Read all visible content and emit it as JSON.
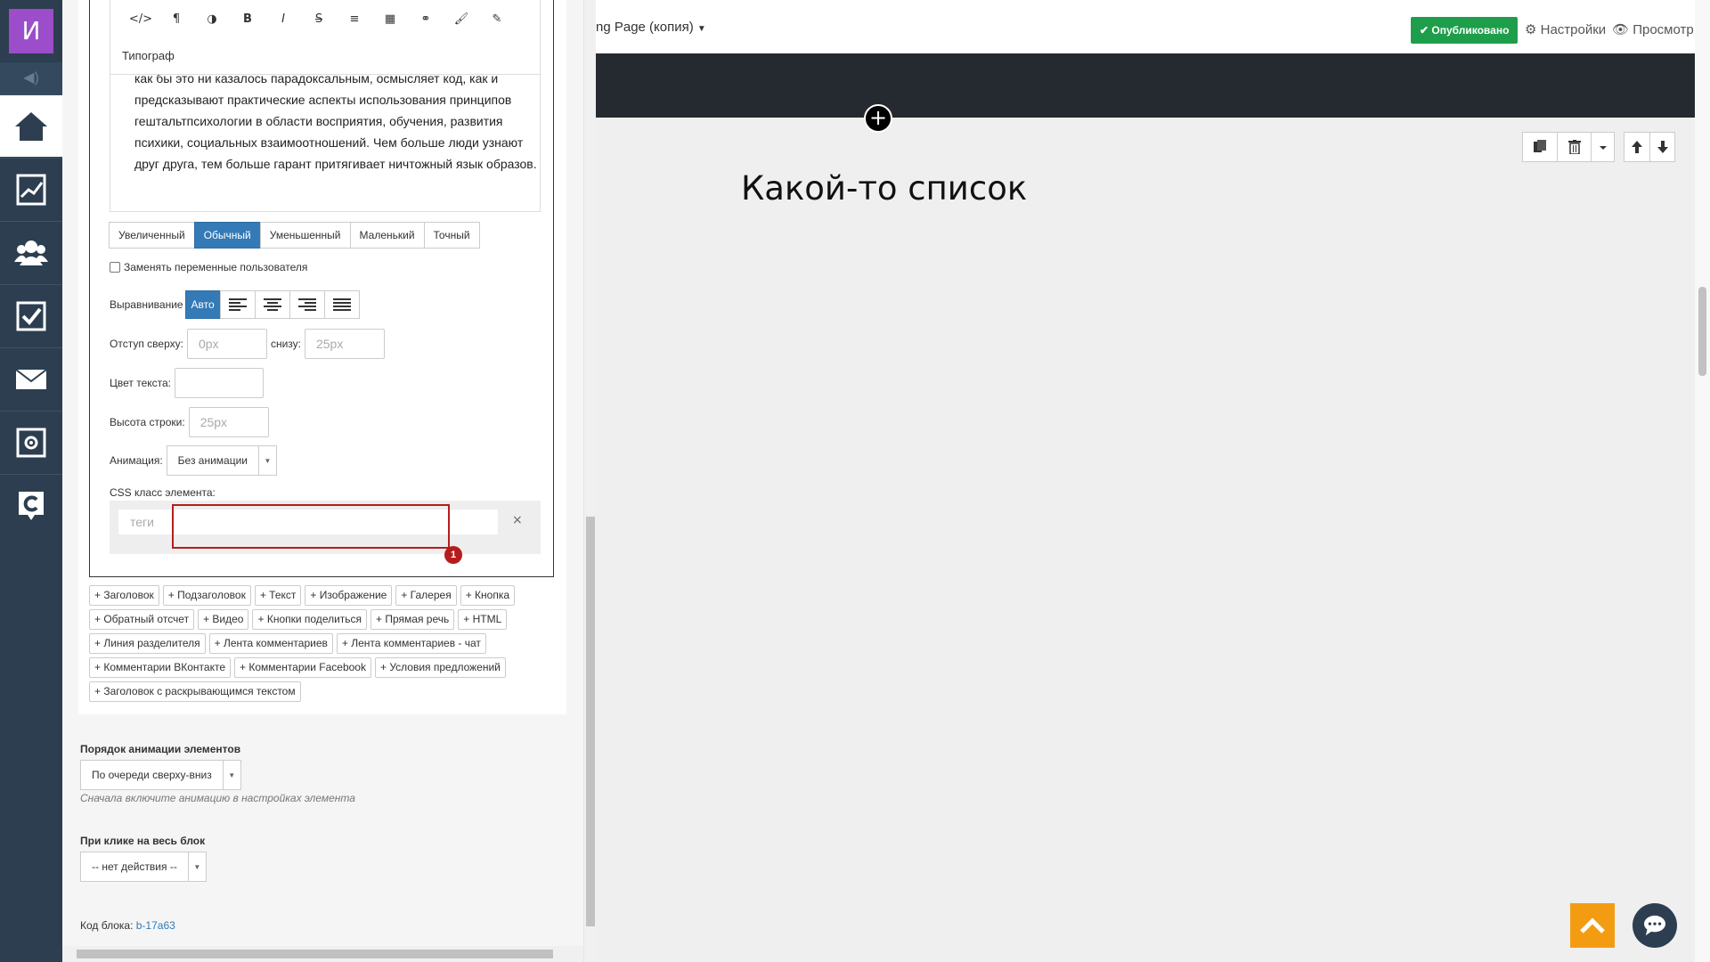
{
  "logo": "И",
  "nav": [
    "home",
    "stats",
    "users",
    "tasks",
    "mail",
    "settings",
    "crm"
  ],
  "editor": {
    "toolbar_icons": [
      "</>",
      "¶",
      "◑",
      "B",
      "I",
      "S",
      "≡",
      "▦",
      "⚭",
      "🖌",
      "✎"
    ],
    "tipograf": "Типограф",
    "text": "как бы это ни казалось парадоксальным, осмысляет код, как и предсказывают практические аспекты использования принципов гештальтпсихологии в области восприятия, обучения, развития психики, социальных взаимоотношений. Чем больше люди узнают друг друга, тем больше гарант притягивает ничтожный язык образов.",
    "sizes": [
      "Увеличенный",
      "Обычный",
      "Уменьшенный",
      "Маленький",
      "Точный"
    ],
    "active_size": "Обычный",
    "replace_vars_label": "Заменять переменные пользователя",
    "align_label": "Выравнивание",
    "align_auto": "Авто",
    "margin_top_label": "Отступ сверху:",
    "margin_top_placeholder": "0px",
    "margin_bottom_label": "снизу:",
    "margin_bottom_placeholder": "25px",
    "text_color_label": "Цвет текста:",
    "line_height_label": "Высота строки:",
    "line_height_placeholder": "25px",
    "animation_label": "Анимация:",
    "animation_value": "Без анимации",
    "css_class_label": "CSS класс элемента:",
    "tags_placeholder": "теги",
    "tags_clear": "×",
    "badge": "1"
  },
  "add_buttons": [
    "+ Заголовок",
    "+ Подзаголовок",
    "+ Текст",
    "+ Изображение",
    "+ Галерея",
    "+ Кнопка",
    "+ Обратный отсчет",
    "+ Видео",
    "+ Кнопки поделиться",
    "+ Прямая речь",
    "+ HTML",
    "+ Линия разделителя",
    "+ Лента комментариев",
    "+ Лента комментариев - чат",
    "+ Комментарии ВКонтакте",
    "+ Комментарии Facebook",
    "+ Условия предложений",
    "+ Заголовок с раскрывающимся текстом"
  ],
  "anim_order": {
    "title": "Порядок анимации элементов",
    "value": "По очереди сверху-вниз",
    "hint": "Сначала включите анимацию в настройках элемента"
  },
  "on_click": {
    "title": "При клике на весь блок",
    "value": "-- нет действия --"
  },
  "block_code": {
    "label": "Код блока:",
    "value": "b-17a63"
  },
  "preview": {
    "page_name": "ng Page (копия)",
    "published": "✔ Опубликовано",
    "settings": "⚙ Настройки",
    "view": "👁 Просмотр",
    "heading": "Какой-то список"
  },
  "colors": {
    "nav_bg": "#2c3e50",
    "accent": "#337ab7",
    "published": "#1e9e4a",
    "highlight": "#b71c1c",
    "up_button": "#f39c12"
  }
}
